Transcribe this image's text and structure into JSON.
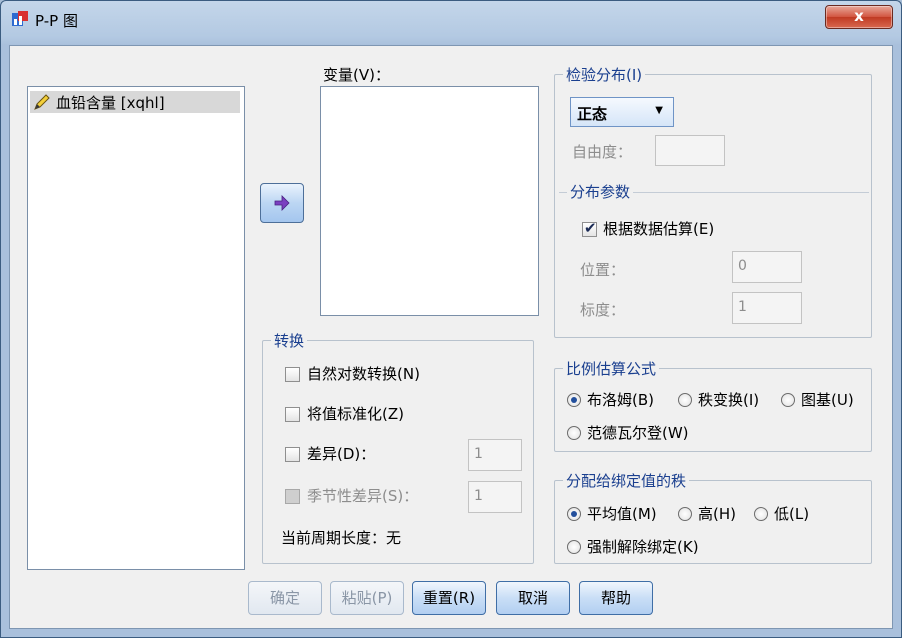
{
  "window": {
    "title": "P-P 图",
    "close": "x"
  },
  "source_list": {
    "items": [
      {
        "label": "血铅含量 [xqhl]"
      }
    ]
  },
  "variables": {
    "label": "变量(V)："
  },
  "test_distribution": {
    "title": "检验分布(I)",
    "selected": "正态",
    "df_label": "自由度：",
    "params": {
      "title": "分布参数",
      "estimate_label": "根据数据估算(E)",
      "location_label": "位置：",
      "location_value": "0",
      "scale_label": "标度：",
      "scale_value": "1"
    }
  },
  "transform": {
    "title": "转换",
    "log_label": "自然对数转换(N)",
    "standardize_label": "将值标准化(Z)",
    "difference_label": "差异(D)：",
    "difference_value": "1",
    "seasonal_label": "季节性差异(S)：",
    "seasonal_value": "1",
    "period_label": "当前周期长度：无"
  },
  "proportion": {
    "title": "比例估算公式",
    "blom": "布洛姆(B)",
    "rankit": "秩变换(I)",
    "tukey": "图基(U)",
    "vdw": "范德瓦尔登(W)"
  },
  "ties": {
    "title": "分配给绑定值的秩",
    "mean": "平均值(M)",
    "high": "高(H)",
    "low": "低(L)",
    "break": "强制解除绑定(K)"
  },
  "buttons": {
    "ok": "确定",
    "paste": "粘贴(P)",
    "reset": "重置(R)",
    "cancel": "取消",
    "help": "帮助"
  }
}
